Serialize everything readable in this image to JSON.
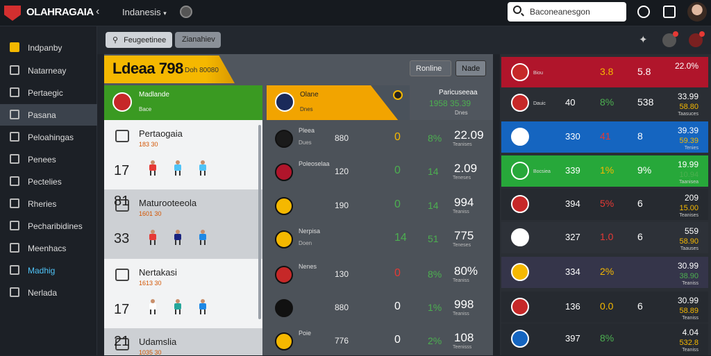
{
  "topbar": {
    "brand": "OLAHRAGAIA",
    "country": "Indanesis",
    "search_placeholder": "Baconeanesgon"
  },
  "sidebar": {
    "items": [
      {
        "label": "Indpanby",
        "icon": "ticket-icon"
      },
      {
        "label": "Natarneay",
        "icon": "user-icon"
      },
      {
        "label": "Pertaegic",
        "icon": "cube-icon"
      },
      {
        "label": "Pasana",
        "icon": "tv-icon"
      },
      {
        "label": "Peloahingas",
        "icon": "book-icon"
      },
      {
        "label": "Penees",
        "icon": "chart-icon"
      },
      {
        "label": "Pectelies",
        "icon": "bookmark-icon"
      },
      {
        "label": "Rheries",
        "icon": "calendar-icon"
      },
      {
        "label": "Pecharibidines",
        "icon": "shirt-icon"
      },
      {
        "label": "Meenhacs",
        "icon": "list-icon"
      },
      {
        "label": "Madhig",
        "icon": "gear-icon"
      },
      {
        "label": "Nerlada",
        "icon": "link-icon"
      }
    ]
  },
  "filters": {
    "search": "Feugeetinee",
    "second": "Zianahiev"
  },
  "banner": {
    "title": "Ldeaa 798",
    "subtitle": "Doh 80080",
    "btn_online": "Ronline",
    "btn_right": "Nade"
  },
  "green_header": {
    "title": "Madlande",
    "sub": "Bace"
  },
  "yellow_header": {
    "title": "Olane",
    "sub": "Dnes"
  },
  "right_header": {
    "title": "Paricuseeaa",
    "value": "1958 35.39",
    "sub": "Dnes"
  },
  "teams": [
    {
      "name": "Pertaogaia",
      "sub": "183 30",
      "num": "17"
    },
    {
      "name": "Maturooteeola",
      "sub": "1601 30",
      "num": "81"
    },
    {
      "name": "Nertakasi",
      "sub": "1613 30",
      "num": "17"
    },
    {
      "name": "Udamslia",
      "sub": "1035 30",
      "num": "21"
    }
  ],
  "team_row_2_num2": "33",
  "matches": [
    {
      "name": "Pleea",
      "sub": "Dues",
      "v1": "880",
      "v2": "0",
      "v3": "8%",
      "v4": "22.09",
      "v5": "Teanises",
      "v2c": "#f5b800",
      "v3c": "#4caf50"
    },
    {
      "name": "Poleoselaa",
      "sub": "",
      "v1": "120",
      "v2": "0",
      "v3": "14",
      "v4": "2.09",
      "v5": "Teneses",
      "v2c": "#4caf50",
      "v3c": "#4caf50"
    },
    {
      "name": "",
      "sub": "",
      "v1": "190",
      "v2": "0",
      "v3": "14",
      "v4": "994",
      "v5": "Teaniss",
      "v2c": "#4caf50",
      "v3c": "#4caf50"
    },
    {
      "name": "Nerpisa",
      "sub": "Doen",
      "v1": "",
      "v2": "14",
      "v3": "51",
      "v4": "775",
      "v5": "Teneses",
      "v2c": "#4caf50",
      "v3c": "#4caf50"
    },
    {
      "name": "Nenes",
      "sub": "",
      "v1": "130",
      "v2": "0",
      "v3": "8%",
      "v4": "80%",
      "v5": "Teaniss",
      "v2c": "#e53935",
      "v3c": "#4caf50"
    },
    {
      "name": "",
      "sub": "",
      "v1": "880",
      "v2": "0",
      "v3": "1%",
      "v4": "998",
      "v5": "Teaniss",
      "v2c": "#fff",
      "v3c": "#4caf50"
    },
    {
      "name": "Poie",
      "sub": "",
      "v1": "776",
      "v2": "0",
      "v3": "2%",
      "v4": "108",
      "v5": "Teenisss",
      "v2c": "#fff",
      "v3c": "#4caf50"
    }
  ],
  "standings": [
    {
      "nm": "Biou",
      "c1": "",
      "c2": "3.8",
      "c3": "5.8",
      "c4": "22.0%",
      "c5": "",
      "c6": "",
      "bg": "#b0152b",
      "c2c": "#f5b800"
    },
    {
      "nm": "Dauic",
      "c1": "40",
      "c2": "8%",
      "c3": "538",
      "c4": "33.99",
      "c5": "58.80",
      "c6": "Taasuces",
      "bg": "#2a2e34",
      "c2c": "#4caf50"
    },
    {
      "nm": "",
      "c1": "330",
      "c2": "41",
      "c3": "8",
      "c4": "39.39",
      "c5": "59.39",
      "c6": "Tenies",
      "bg": "#1565c0",
      "c2c": "#e53935"
    },
    {
      "nm": "Bocsiea",
      "c1": "339",
      "c2": "1%",
      "c3": "9%",
      "c4": "19.99",
      "c5": "10.94",
      "c6": "Taanisea",
      "bg": "#27a83a",
      "c2c": "#f5b800"
    },
    {
      "nm": "",
      "c1": "394",
      "c2": "5%",
      "c3": "6",
      "c4": "209",
      "c5": "15.00",
      "c6": "Teanises",
      "bg": "#262a30",
      "c2c": "#e53935"
    },
    {
      "nm": "",
      "c1": "327",
      "c2": "1.0",
      "c3": "6",
      "c4": "559",
      "c5": "58.90",
      "c6": "Taauses",
      "bg": "#2d3138",
      "c2c": "#e53935"
    },
    {
      "nm": "",
      "c1": "334",
      "c2": "2%",
      "c3": "",
      "c4": "30.99",
      "c5": "38.90",
      "c6": "Teaniss",
      "bg": "#35354a",
      "c2c": "#f5b800"
    },
    {
      "nm": "",
      "c1": "136",
      "c2": "0.0",
      "c3": "6",
      "c4": "30.99",
      "c5": "58.89",
      "c6": "Teaniss",
      "bg": "#262a30",
      "c2c": "#f5b800"
    },
    {
      "nm": "",
      "c1": "397",
      "c2": "8%",
      "c3": "",
      "c4": "4.04",
      "c5": "532.8",
      "c6": "Teaniss",
      "bg": "#262a30",
      "c2c": "#4caf50"
    }
  ]
}
